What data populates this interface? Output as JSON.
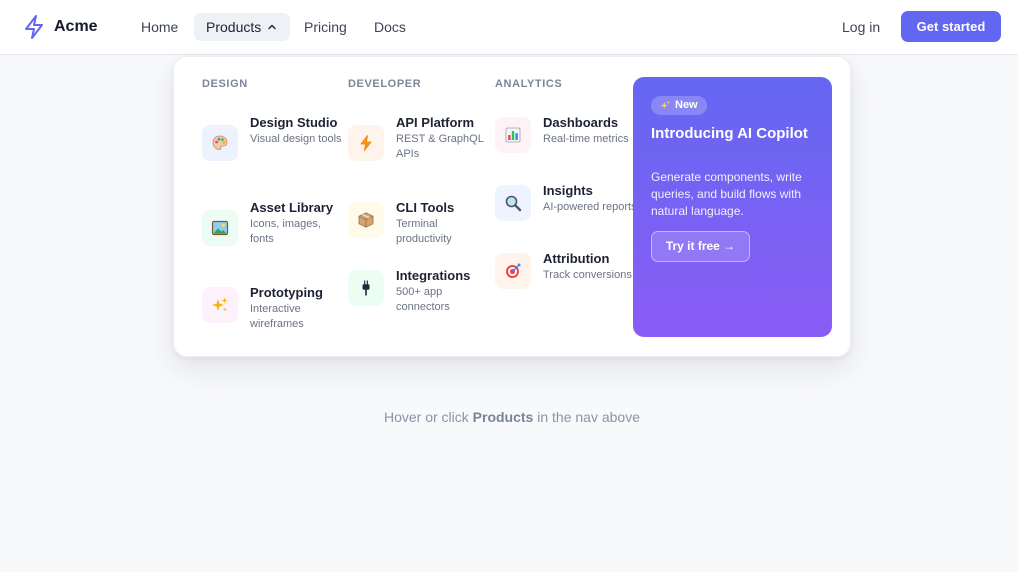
{
  "brand": {
    "name": "Acme",
    "icon": "lightning-bolt-icon",
    "accent": "#6366f1"
  },
  "nav": {
    "home": "Home",
    "products": "Products",
    "pricing": "Pricing",
    "docs": "Docs",
    "login": "Log in",
    "get_started": "Get started"
  },
  "dropdown": {
    "columns": [
      {
        "heading": "DESIGN",
        "items": [
          {
            "title": "Design Studio",
            "desc": "Visual design tools",
            "icon": "palette-icon",
            "color": "#eef2ff"
          },
          {
            "title": "Asset Library",
            "desc": "Icons, images, fonts",
            "icon": "picture-icon",
            "color": "#ecfdf3"
          },
          {
            "title": "Prototyping",
            "desc": "Interactive wireframes",
            "icon": "sparkles-icon",
            "color": "#fdf2fb"
          }
        ]
      },
      {
        "heading": "DEVELOPER",
        "items": [
          {
            "title": "API Platform",
            "desc": "REST & GraphQL APIs",
            "icon": "lightning-icon",
            "color": "#fff4ec"
          },
          {
            "title": "CLI Tools",
            "desc": "Terminal productivity",
            "icon": "package-icon",
            "color": "#fffbea"
          },
          {
            "title": "Integrations",
            "desc": "500+ app connectors",
            "icon": "plug-icon",
            "color": "#ecfdf3"
          }
        ]
      },
      {
        "heading": "ANALYTICS",
        "items": [
          {
            "title": "Dashboards",
            "desc": "Real-time metrics",
            "icon": "bar-chart-icon",
            "color": "#fdf2f6"
          },
          {
            "title": "Insights",
            "desc": "AI-powered reports",
            "icon": "magnifier-icon",
            "color": "#eef4ff"
          },
          {
            "title": "Attribution",
            "desc": "Track conversions",
            "icon": "target-icon",
            "color": "#fff4ec"
          }
        ]
      }
    ],
    "promo": {
      "badge": "New",
      "badge_icon": "sparkles-icon",
      "title": "Introducing AI Copilot",
      "desc": "Generate components, write queries, and build flows with natural language.",
      "cta": "Try it free →"
    }
  },
  "hint": {
    "before": "Hover or click ",
    "strong": "Products",
    "after": " in the nav above"
  }
}
